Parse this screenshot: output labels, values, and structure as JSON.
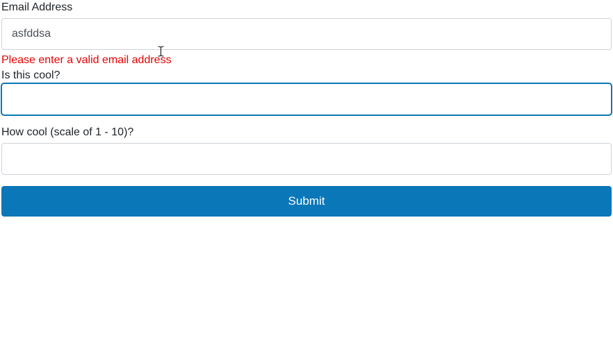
{
  "form": {
    "email": {
      "label": "Email Address",
      "value": "asfddsa",
      "error": "Please enter a valid email address"
    },
    "cool": {
      "label": "Is this cool?",
      "value": ""
    },
    "scale": {
      "label": "How cool (scale of 1 - 10)?",
      "value": ""
    },
    "submit": {
      "label": "Submit"
    }
  }
}
